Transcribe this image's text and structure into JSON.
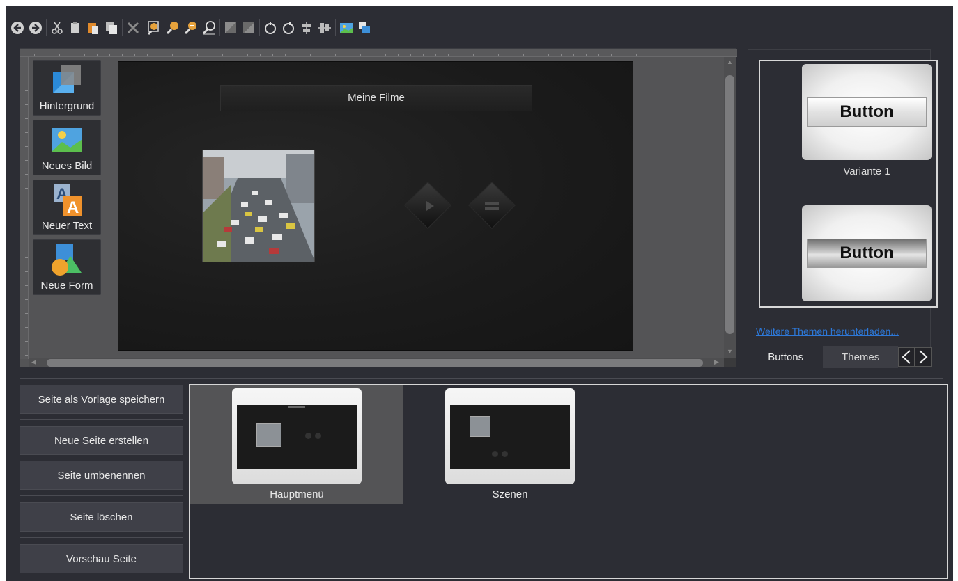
{
  "toolbar": {
    "icons": [
      "back-icon",
      "forward-icon",
      "cut-icon",
      "copy-icon",
      "paste-icon",
      "duplicate-icon",
      "delete-icon",
      "zoom-fit-icon",
      "zoom-in-icon",
      "zoom-out-icon",
      "zoom-reset-icon",
      "bring-front-icon",
      "send-back-icon",
      "rotate-left-icon",
      "rotate-right-icon",
      "align-h-icon",
      "align-v-icon",
      "insert-image-icon",
      "layers-icon"
    ]
  },
  "editor": {
    "tools": [
      {
        "label": "Hintergrund",
        "icon": "background-icon"
      },
      {
        "label": "Neues Bild",
        "icon": "image-icon"
      },
      {
        "label": "Neuer Text",
        "icon": "text-icon"
      },
      {
        "label": "Neue Form",
        "icon": "shape-icon"
      }
    ],
    "canvas": {
      "title": "Meine Filme"
    }
  },
  "panel": {
    "variants": [
      {
        "button_text": "Button",
        "label": "Variante 1"
      },
      {
        "button_text": "Button",
        "label": ""
      }
    ],
    "more_link": "Weitere Themen herunterladen...",
    "tabs": [
      "Buttons",
      "Themes"
    ],
    "nav": [
      "<",
      ">"
    ]
  },
  "page_actions": [
    "Seite als Vorlage speichern",
    "Neue Seite erstellen",
    "Seite umbenennen",
    "Seite löschen",
    "Vorschau Seite"
  ],
  "pages": [
    {
      "label": "Hauptmenü",
      "selected": true
    },
    {
      "label": "Szenen",
      "selected": false
    }
  ],
  "colors": {
    "background": "#2c2d34",
    "selection": "#545456",
    "link": "#2d78d8"
  }
}
